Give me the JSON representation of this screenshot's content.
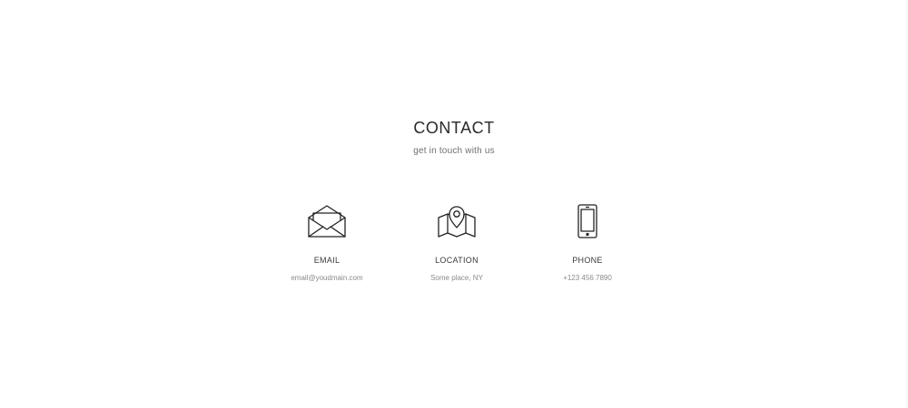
{
  "section": {
    "title": "CONTACT",
    "subtitle": "get in touch with us"
  },
  "contacts": [
    {
      "icon": "envelope-icon",
      "label": "EMAIL",
      "value": "email@youdmain.com"
    },
    {
      "icon": "map-pin-icon",
      "label": "LOCATION",
      "value": "Some place, NY"
    },
    {
      "icon": "smartphone-icon",
      "label": "PHONE",
      "value": "+123 456 7890"
    }
  ],
  "colors": {
    "text_dark": "#2a2a2a",
    "text_muted": "#8a8a8a",
    "background": "#ffffff"
  }
}
